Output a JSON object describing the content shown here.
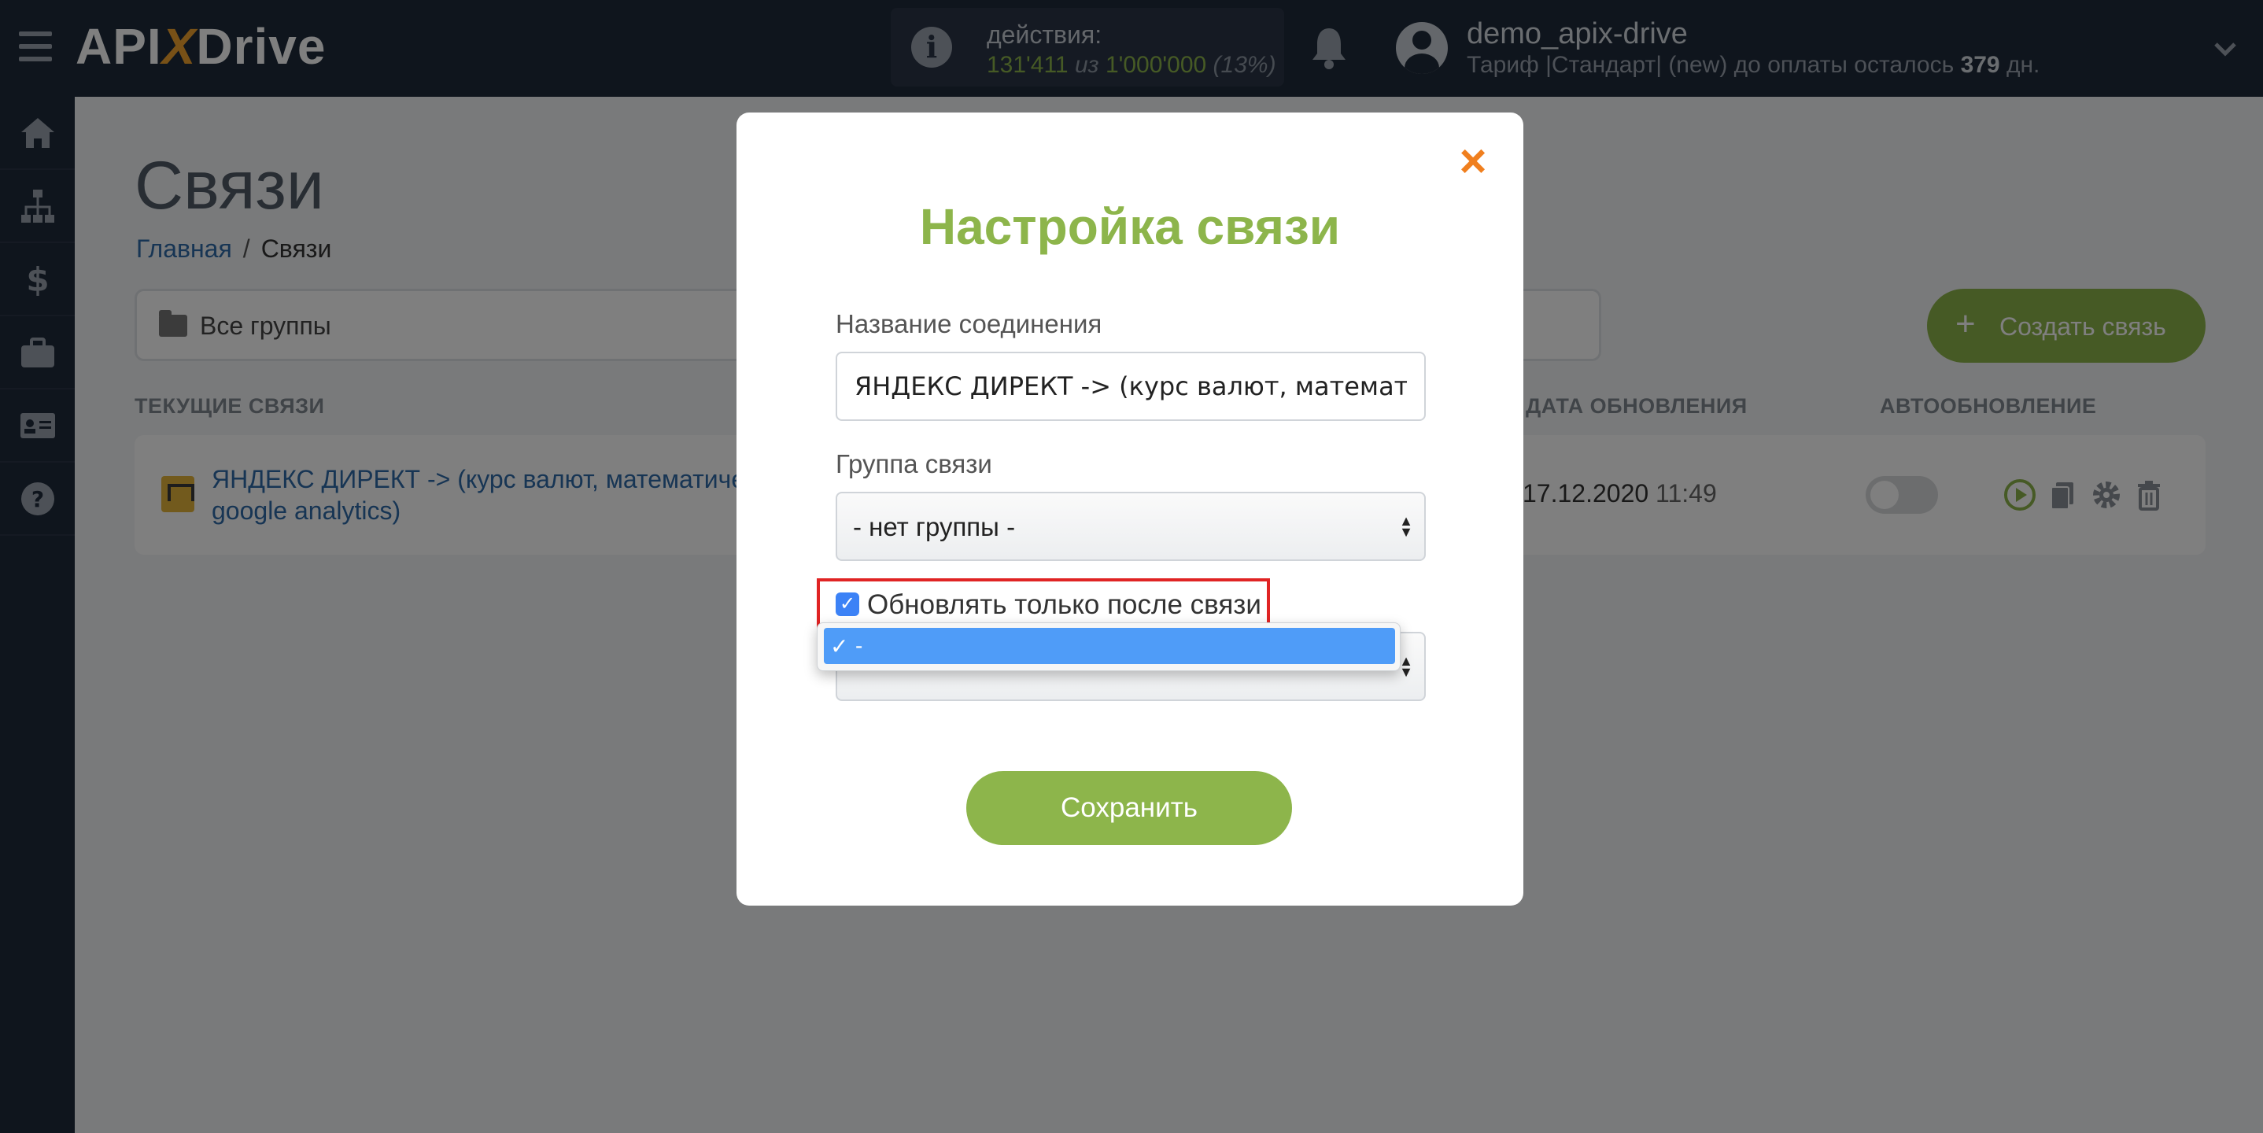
{
  "header": {
    "logo_api": "API",
    "logo_x": "X",
    "logo_drive": "Drive",
    "actions_label": "действия:",
    "actions_used": "131'411",
    "actions_of": "из",
    "actions_limit": "1'000'000",
    "actions_pct": "(13%)",
    "username": "demo_apix-drive",
    "tariff_text": "Тариф |Стандарт| (new) до оплаты осталось",
    "tariff_days": "379",
    "tariff_suffix": "дн."
  },
  "sidebar": {
    "items": [
      "home-icon",
      "sitemap-icon",
      "dollar-icon",
      "briefcase-icon",
      "id-card-icon",
      "help-icon"
    ]
  },
  "main": {
    "title": "Связи",
    "breadcrumb": {
      "home": "Главная",
      "separator": "/",
      "current": "Связи"
    },
    "group_filter": "Все группы",
    "create_button": "Создать связь",
    "columns": {
      "current": "ТЕКУЩИЕ СВЯЗИ",
      "updated": "ДАТА ОБНОВЛЕНИЯ",
      "auto": "АВТООБНОВЛЕНИЕ"
    },
    "connection": {
      "name": "ЯНДЕКС ДИРЕКТ -> (курс валют, математиче google analytics)",
      "date": "17.12.2020",
      "time": "11:49",
      "autoupdate": false
    }
  },
  "modal": {
    "title": "Настройка связи",
    "name_label": "Название соединения",
    "name_value": "ЯНДЕКС ДИРЕКТ -> (курс валют, математическ",
    "group_label": "Группа связи",
    "group_value": "- нет группы -",
    "checkbox_label": "Обновлять только после связи",
    "checkbox_checked": true,
    "dropdown_option": "-",
    "save_button": "Сохранить"
  },
  "colors": {
    "brand_green": "#8db54b",
    "header_bg": "#1f2a3a",
    "close_orange": "#f07f1e",
    "highlight_red": "#e02424",
    "select_blue": "#4f9cf8"
  }
}
